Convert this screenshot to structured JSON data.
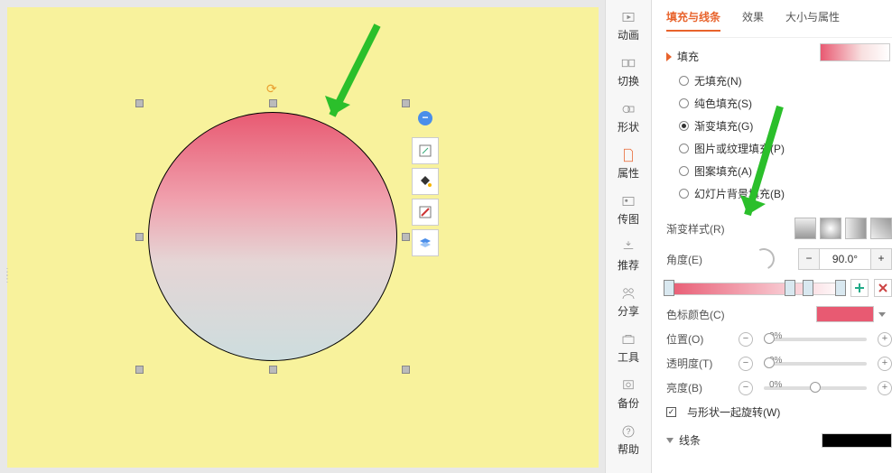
{
  "rail": {
    "anim": "动画",
    "trans": "切换",
    "shape": "形状",
    "attr": "属性",
    "img": "传图",
    "rec": "推荐",
    "share": "分享",
    "tool": "工具",
    "backup": "备份",
    "help": "帮助"
  },
  "tabs": {
    "fillLine": "填充与线条",
    "effect": "效果",
    "sizeProp": "大小与属性"
  },
  "fill": {
    "section": "填充",
    "none": "无填充(N)",
    "solid": "纯色填充(S)",
    "gradient": "渐变填充(G)",
    "picture": "图片或纹理填充(P)",
    "pattern": "图案填充(A)",
    "slideBg": "幻灯片背景填充(B)"
  },
  "grad": {
    "styleLabel": "渐变样式(R)",
    "angleLabel": "角度(E)",
    "angleValue": "90.0°",
    "stopColor": "色标颜色(C)",
    "position": "位置(O)",
    "posPct": "0%",
    "transparency": "透明度(T)",
    "transPct": "0%",
    "brightness": "亮度(B)",
    "brightPct": "0%",
    "rotateWith": "与形状一起旋转(W)"
  },
  "line": {
    "section": "线条"
  }
}
